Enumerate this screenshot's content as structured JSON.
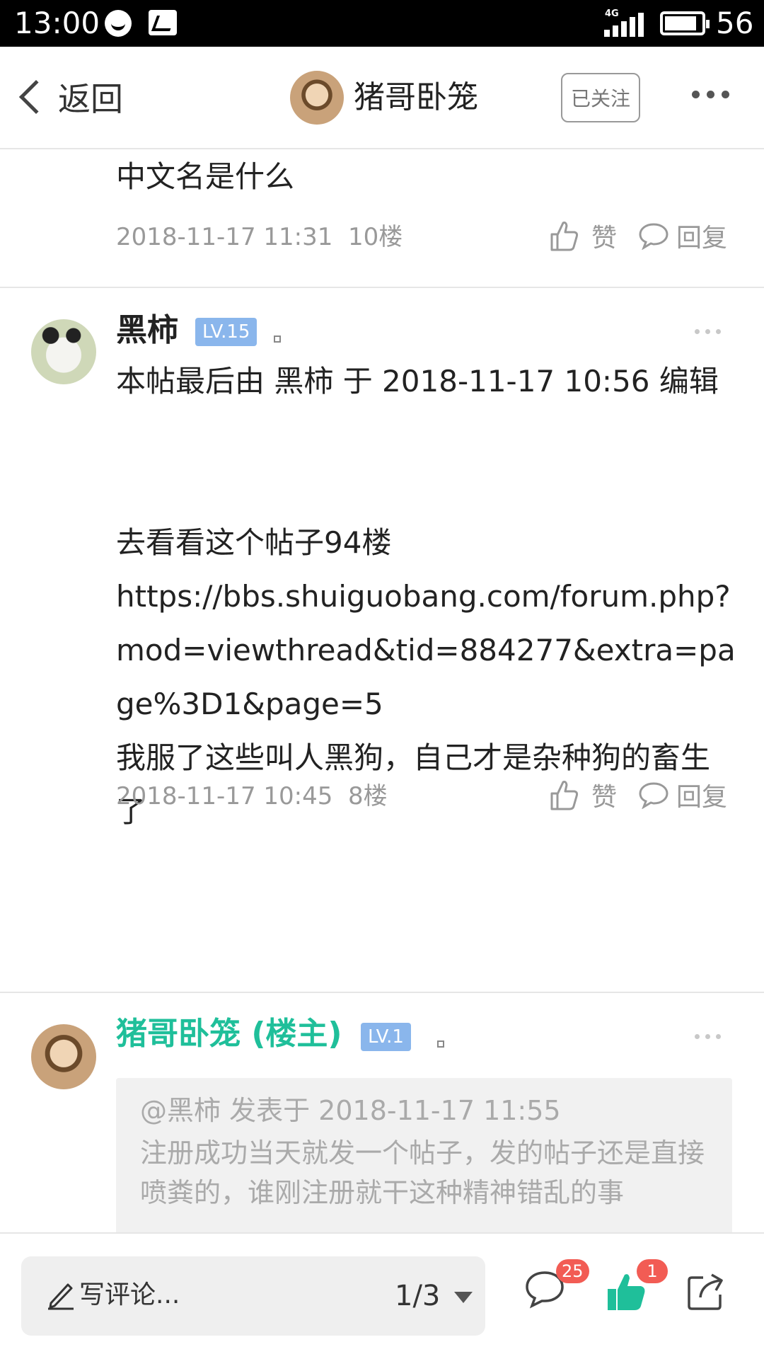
{
  "status_bar": {
    "time": "13:00",
    "network": "4G",
    "battery": "56",
    "icons": [
      "face-icon",
      "photo-icon",
      "signal-icon",
      "battery-icon"
    ]
  },
  "nav": {
    "back_label": "返回",
    "thread_author": "猪哥卧笼",
    "follow_label": "已关注"
  },
  "posts": [
    {
      "body": "中文名是什么",
      "date": "2018-11-17 11:31",
      "floor": "10楼",
      "like_label": "赞",
      "reply_label": "回复"
    },
    {
      "author": "黑柿",
      "level": "LV.15",
      "body_lines": [
        "本帖最后由 黑柿 于 2018-11-17 10:56 编辑",
        "去看看这个帖子94楼",
        "https://bbs.shuiguobang.com/forum.php?mod=viewthread&tid=884277&extra=page%3D1&page=5",
        "我服了这些叫人黑狗，自己才是杂种狗的畜生了"
      ],
      "date": "2018-11-17 10:45",
      "floor": "8楼",
      "like_label": "赞",
      "reply_label": "回复"
    },
    {
      "author": "猪哥卧笼 (楼主)",
      "level": "LV.1",
      "quote_header": "@黑柿 发表于 2018-11-17 11:55",
      "quote_body": "注册成功当天就发一个帖子，发的帖子还是直接喷粪的，谁刚注册就干这种精神错乱的事"
    }
  ],
  "bottom_bar": {
    "comment_placeholder": "写评论...",
    "page_indicator": "1/3",
    "comment_count": "25",
    "like_count": "1"
  },
  "colors": {
    "accent": "#1fbf9a",
    "level_badge": "#8ab6ec",
    "count_badge": "#f25c54"
  }
}
